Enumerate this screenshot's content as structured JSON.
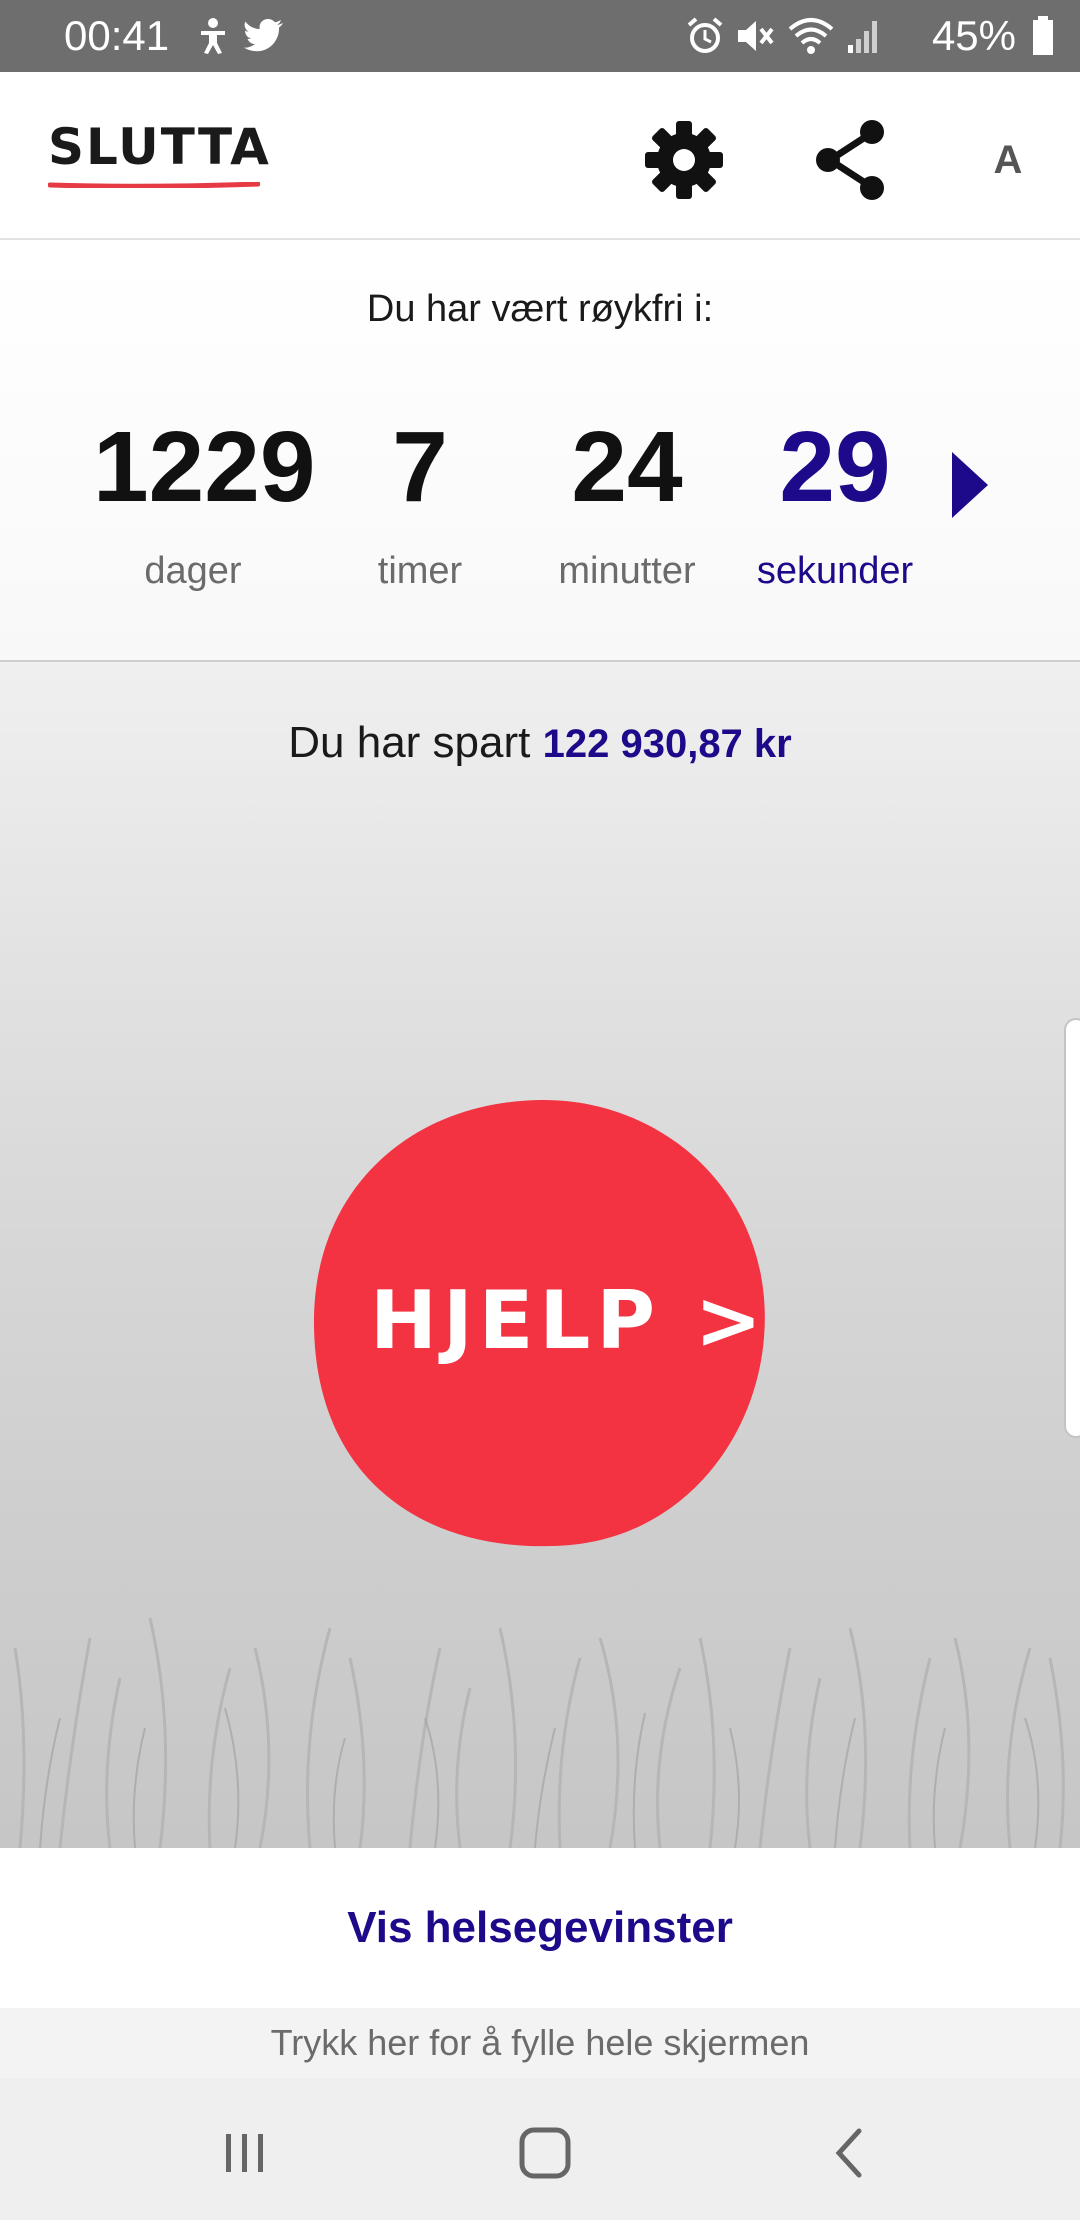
{
  "status_bar": {
    "time": "00:41",
    "battery": "45%",
    "left_icons": [
      "accessibility-icon",
      "twitter-icon"
    ],
    "right_icons": [
      "alarm-icon",
      "mute-icon",
      "wifi-icon",
      "signal-icon",
      "battery-icon"
    ]
  },
  "header": {
    "logo_text": "SLUTTA",
    "logo_accent_color": "#e63a45",
    "font_size_label": "A",
    "icons": [
      "gear-icon",
      "share-icon"
    ]
  },
  "counter": {
    "title": "Du har vært røykfri i:",
    "units": [
      {
        "value": "1229",
        "label": "dager"
      },
      {
        "value": "7",
        "label": "timer"
      },
      {
        "value": "24",
        "label": "minutter"
      },
      {
        "value": "29",
        "label": "sekunder"
      }
    ],
    "accent_color": "#1c0a8a"
  },
  "savings": {
    "prefix": "Du har spart",
    "amount": "122 930,87 kr"
  },
  "help_button": {
    "label": "HJELP >",
    "color": "#f33242"
  },
  "health_link": {
    "label": "Vis helsegevinster"
  },
  "fullscreen_hint": "Trykk her for å fylle hele skjermen",
  "nav_bar": {
    "icons": [
      "recent-apps-icon",
      "home-icon",
      "back-icon"
    ]
  }
}
